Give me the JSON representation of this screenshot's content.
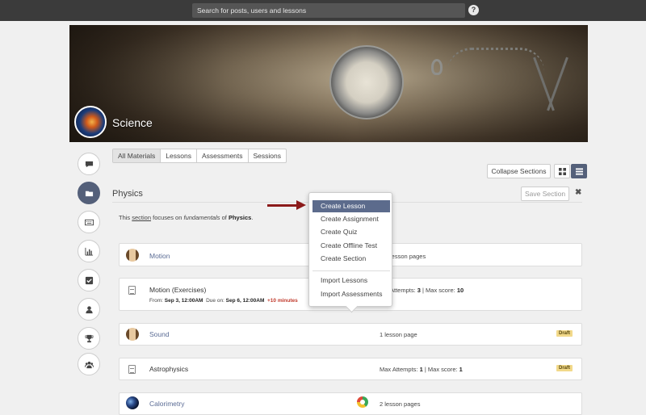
{
  "topbar": {
    "search_placeholder": "Search for posts, users and lessons",
    "help_label": "?"
  },
  "course": {
    "title": "Science"
  },
  "sidebar": {
    "items": [
      {
        "name": "sidebar-item-discussions",
        "icon": "comment-icon"
      },
      {
        "name": "sidebar-item-materials",
        "icon": "folder-icon",
        "active": true
      },
      {
        "name": "sidebar-item-gradebook",
        "icon": "keyboard-icon"
      },
      {
        "name": "sidebar-item-analytics",
        "icon": "bar-chart-icon"
      },
      {
        "name": "sidebar-item-attendance",
        "icon": "checkbox-icon"
      },
      {
        "name": "sidebar-item-members",
        "icon": "user-icon"
      },
      {
        "name": "sidebar-item-badges",
        "icon": "trophy-icon"
      },
      {
        "name": "sidebar-item-groups",
        "icon": "group-icon"
      }
    ]
  },
  "tabs": [
    {
      "label": "All Materials",
      "active": true
    },
    {
      "label": "Lessons"
    },
    {
      "label": "Assessments"
    },
    {
      "label": "Sessions"
    }
  ],
  "toolbar": {
    "collapse_label": "Collapse Sections",
    "save_section_label": "Save Section",
    "close_label": "✖"
  },
  "section": {
    "title": "Physics",
    "desc_pre": "This ",
    "desc_link": "section",
    "desc_mid": " focuses on ",
    "desc_em": "fundamentals",
    "desc_mid2": " of ",
    "desc_bold": "Physics",
    "desc_end": "."
  },
  "rows": [
    {
      "name": "Motion",
      "info": "lesson pages"
    },
    {
      "name": "Motion (Exercises)",
      "attempts_label": "Attempts: ",
      "attempts_value": "3",
      "maxscore_label": " | Max score: ",
      "maxscore_value": "10",
      "from_label": "From: ",
      "from_value": "Sep 3, 12:00AM",
      "due_label": "Due on: ",
      "due_value": "Sep 6, 12:00AM",
      "late": "+10 minutes"
    },
    {
      "name": "Sound",
      "info": "1 lesson page",
      "badge": "Draft"
    },
    {
      "name": "Astrophysics",
      "attempts_label": "Max Attempts: ",
      "attempts_value": "1",
      "maxscore_label": " | Max score: ",
      "maxscore_value": "1",
      "badge": "Draft"
    },
    {
      "name": "Calorimetry",
      "info": "2 lesson pages"
    }
  ],
  "create_menu": {
    "items": [
      "Create Lesson",
      "Create Assignment",
      "Create Quiz",
      "Create Offline Test",
      "Create Section"
    ],
    "items2": [
      "Import Lessons",
      "Import Assessments"
    ]
  },
  "colors": {
    "accent": "#54607a",
    "menu_active": "#5c6b8c",
    "arrow": "#8b1a1a",
    "draft_badge": "#f2d98a",
    "late": "#c0392b"
  }
}
